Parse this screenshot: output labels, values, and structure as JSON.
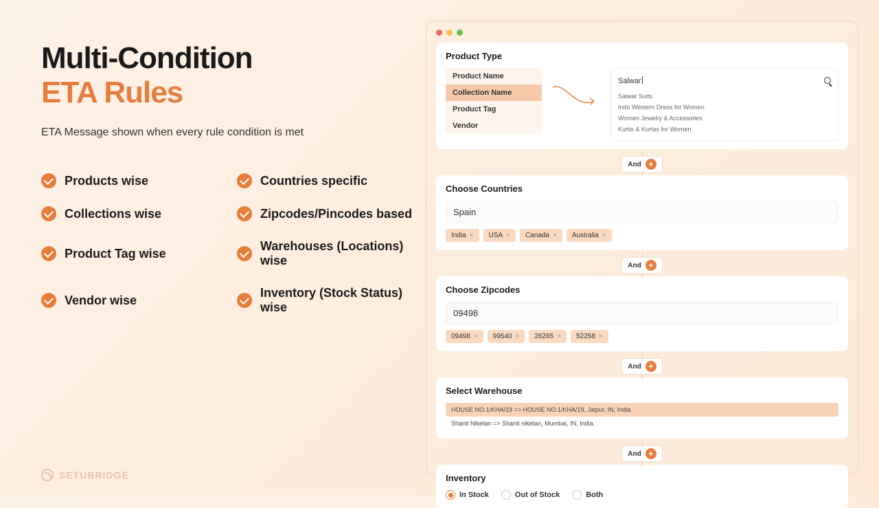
{
  "headline": {
    "line1": "Multi-Condition",
    "line2": "ETA Rules"
  },
  "subtitle": "ETA Message shown when every rule condition is met",
  "features": [
    "Products wise",
    "Countries specific",
    "Collections wise",
    "Zipcodes/Pincodes based",
    "Product Tag wise",
    "Warehouses (Locations) wise",
    "Vendor wise",
    "Inventory (Stock Status) wise"
  ],
  "brand": "SETUBRIDGE",
  "and_label": "And",
  "plus_label": "+",
  "product_type": {
    "title": "Product Type",
    "items": [
      "Product Name",
      "Collection Name",
      "Product Tag",
      "Vendor"
    ],
    "active_index": 1,
    "search_value": "Salwar",
    "suggestions": [
      "Salwar Suits",
      "Indo Western Dress for Women",
      "Women Jewelry & Accessories",
      "Kurtis & Kurtas for Women"
    ]
  },
  "countries": {
    "title": "Choose Countries",
    "input": "Spain",
    "chips": [
      "India",
      "USA",
      "Canada",
      "Australia"
    ]
  },
  "zipcodes": {
    "title": "Choose Zipcodes",
    "input": "09498",
    "chips": [
      "09498",
      "99540",
      "26265",
      "52258"
    ]
  },
  "warehouse": {
    "title": "Select Warehouse",
    "items": [
      "HOUSE NO.1/KHA/19 => HOUSE NO.1/KHA/19, Jaipur, IN, India",
      "Shanti Niketan => Shanti niketan, Mumbai, IN, India."
    ],
    "selected_index": 0
  },
  "inventory": {
    "title": "Inventory",
    "options": [
      "In Stock",
      "Out of Stock",
      "Both"
    ],
    "selected_index": 0
  }
}
